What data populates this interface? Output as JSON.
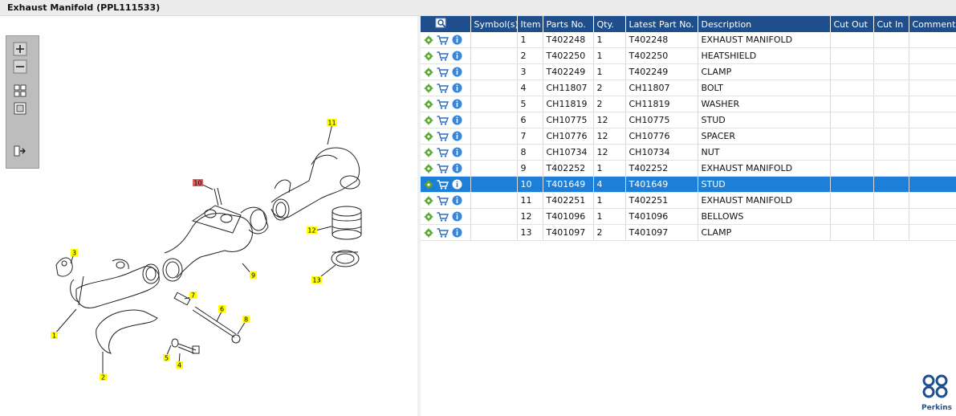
{
  "title": "Exhaust Manifold (PPL111533)",
  "toolbox": {
    "items": [
      "zoom-in-icon",
      "zoom-out-icon",
      "fit-all-icon",
      "fit-window-icon",
      "export-icon"
    ]
  },
  "diagram": {
    "callouts": [
      "1",
      "2",
      "3",
      "4",
      "5",
      "6",
      "7",
      "8",
      "9",
      "10",
      "11",
      "12",
      "13"
    ],
    "highlighted_callout": "10",
    "colors": {
      "callout": "#ffff00",
      "highlight": "#e06060"
    }
  },
  "table": {
    "columns": [
      "",
      "Symbol(s)",
      "Item",
      "Parts No.",
      "Qty.",
      "Latest Part No.",
      "Description",
      "Cut Out",
      "Cut In",
      "Comment"
    ],
    "rows": [
      {
        "item": "1",
        "part": "T402248",
        "qty": "1",
        "latest": "T402248",
        "desc": "EXHAUST MANIFOLD"
      },
      {
        "item": "2",
        "part": "T402250",
        "qty": "1",
        "latest": "T402250",
        "desc": "HEATSHIELD"
      },
      {
        "item": "3",
        "part": "T402249",
        "qty": "1",
        "latest": "T402249",
        "desc": "CLAMP"
      },
      {
        "item": "4",
        "part": "CH11807",
        "qty": "2",
        "latest": "CH11807",
        "desc": "BOLT"
      },
      {
        "item": "5",
        "part": "CH11819",
        "qty": "2",
        "latest": "CH11819",
        "desc": "WASHER"
      },
      {
        "item": "6",
        "part": "CH10775",
        "qty": "12",
        "latest": "CH10775",
        "desc": "STUD"
      },
      {
        "item": "7",
        "part": "CH10776",
        "qty": "12",
        "latest": "CH10776",
        "desc": "SPACER"
      },
      {
        "item": "8",
        "part": "CH10734",
        "qty": "12",
        "latest": "CH10734",
        "desc": "NUT"
      },
      {
        "item": "9",
        "part": "T402252",
        "qty": "1",
        "latest": "T402252",
        "desc": "EXHAUST MANIFOLD"
      },
      {
        "item": "10",
        "part": "T401649",
        "qty": "4",
        "latest": "T401649",
        "desc": "STUD"
      },
      {
        "item": "11",
        "part": "T402251",
        "qty": "1",
        "latest": "T402251",
        "desc": "EXHAUST MANIFOLD"
      },
      {
        "item": "12",
        "part": "T401096",
        "qty": "1",
        "latest": "T401096",
        "desc": "BELLOWS"
      },
      {
        "item": "13",
        "part": "T401097",
        "qty": "2",
        "latest": "T401097",
        "desc": "CLAMP"
      }
    ],
    "selected_item": "10",
    "row_icons": [
      "settings-icon",
      "cart-icon",
      "info-icon"
    ],
    "colors": {
      "header": "#1f4e8c",
      "selected": "#1e7fd8"
    }
  },
  "brand": {
    "name": "Perkins",
    "color": "#1d4f91"
  }
}
